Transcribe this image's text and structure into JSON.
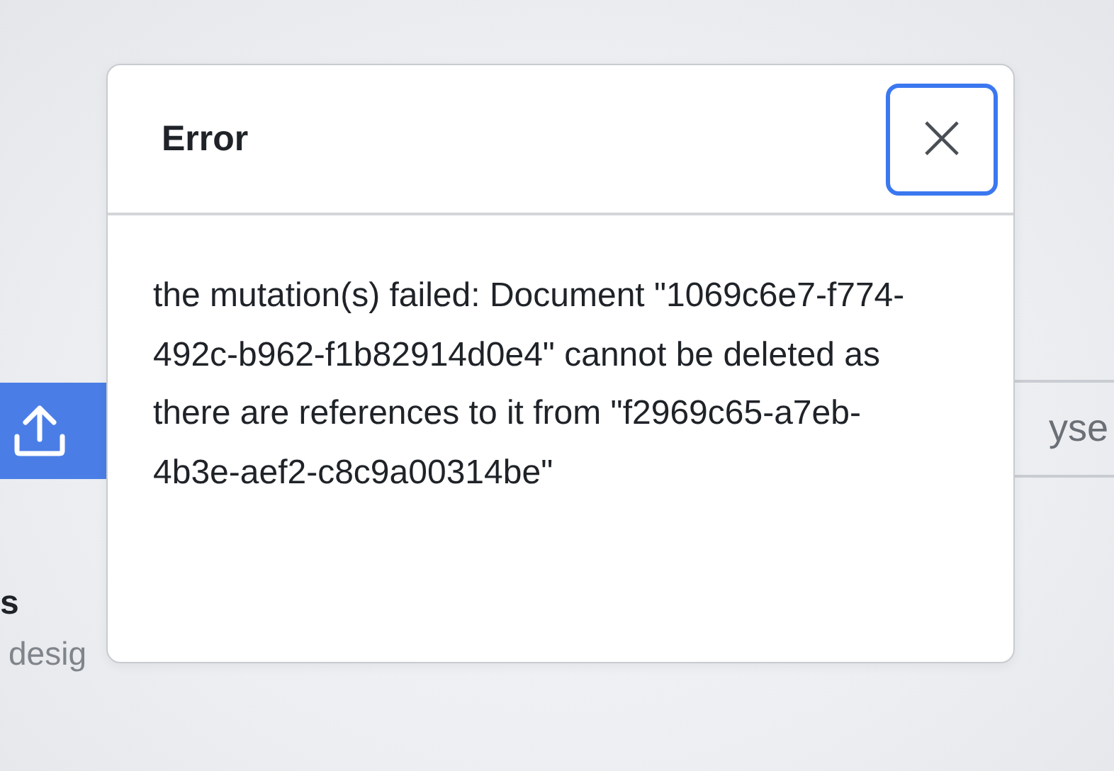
{
  "background": {
    "browse_field": {
      "text": "yse"
    },
    "section": {
      "title": "s",
      "subtitle": "desig"
    }
  },
  "dialog": {
    "title": "Error",
    "close": {
      "symbol": "×",
      "focused": true
    },
    "message": "the mutation(s) failed: Document \"1069c6e7-f774-492c-b962-f1b82914d0e4\" cannot be deleted as there are references to it from \"f2969c65-a7eb-4b3e-aef2-c8c9a00314be\""
  }
}
